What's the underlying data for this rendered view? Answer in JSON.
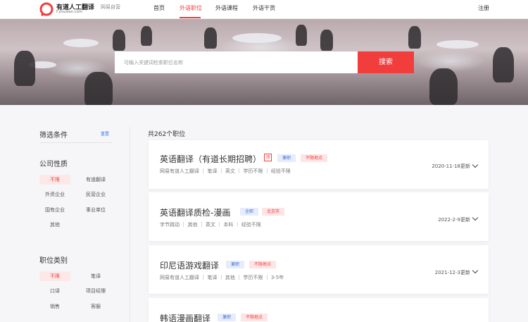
{
  "header": {
    "logo_text": "有道人工翻译",
    "logo_sub": "f.youdao.com",
    "brand": "网易自营",
    "nav": [
      "首页",
      "外语职位",
      "外语课程",
      "外语干货"
    ],
    "register": "注册",
    "accent_color": "#f23d3d"
  },
  "search": {
    "placeholder": "可输入关键词检索职位名称",
    "button": "搜索"
  },
  "filter": {
    "title": "筛选条件",
    "reset": "重置",
    "company_type": {
      "title": "公司性质",
      "options": [
        "不限",
        "有道翻译",
        "外资企业",
        "民营企业",
        "国有企业",
        "事业单位",
        "其他"
      ],
      "selected": "不限"
    },
    "job_category": {
      "title": "职位类别",
      "options": [
        "不限",
        "笔译",
        "口译",
        "项目经理",
        "销售",
        "客服"
      ],
      "selected": "不限"
    }
  },
  "list": {
    "count_text": "共262个职位",
    "jobs": [
      {
        "title": "英语翻译（有道长期招聘）",
        "top_badge": "顶",
        "tags": [
          "兼职",
          "不限地点"
        ],
        "meta": [
          "网易有道人工翻译",
          "笔译",
          "英文",
          "学历不限",
          "经验不限"
        ],
        "date": "2020-11-18更新"
      },
      {
        "title": "英语翻译质检-漫画",
        "tags": [
          "全职",
          "北京市"
        ],
        "meta": [
          "字节跳动",
          "其他",
          "英文",
          "本科",
          "经验不限"
        ],
        "date": "2022-2-9更新"
      },
      {
        "title": "印尼语游戏翻译",
        "tags": [
          "兼职",
          "不限地点"
        ],
        "meta": [
          "网易有道人工翻译",
          "笔译",
          "其他",
          "学历不限",
          "3-5年"
        ],
        "date": "2021-12-3更新"
      },
      {
        "title": "韩语漫画翻译",
        "tags": [
          "兼职",
          "不限地点"
        ],
        "meta": [],
        "date": ""
      }
    ]
  }
}
